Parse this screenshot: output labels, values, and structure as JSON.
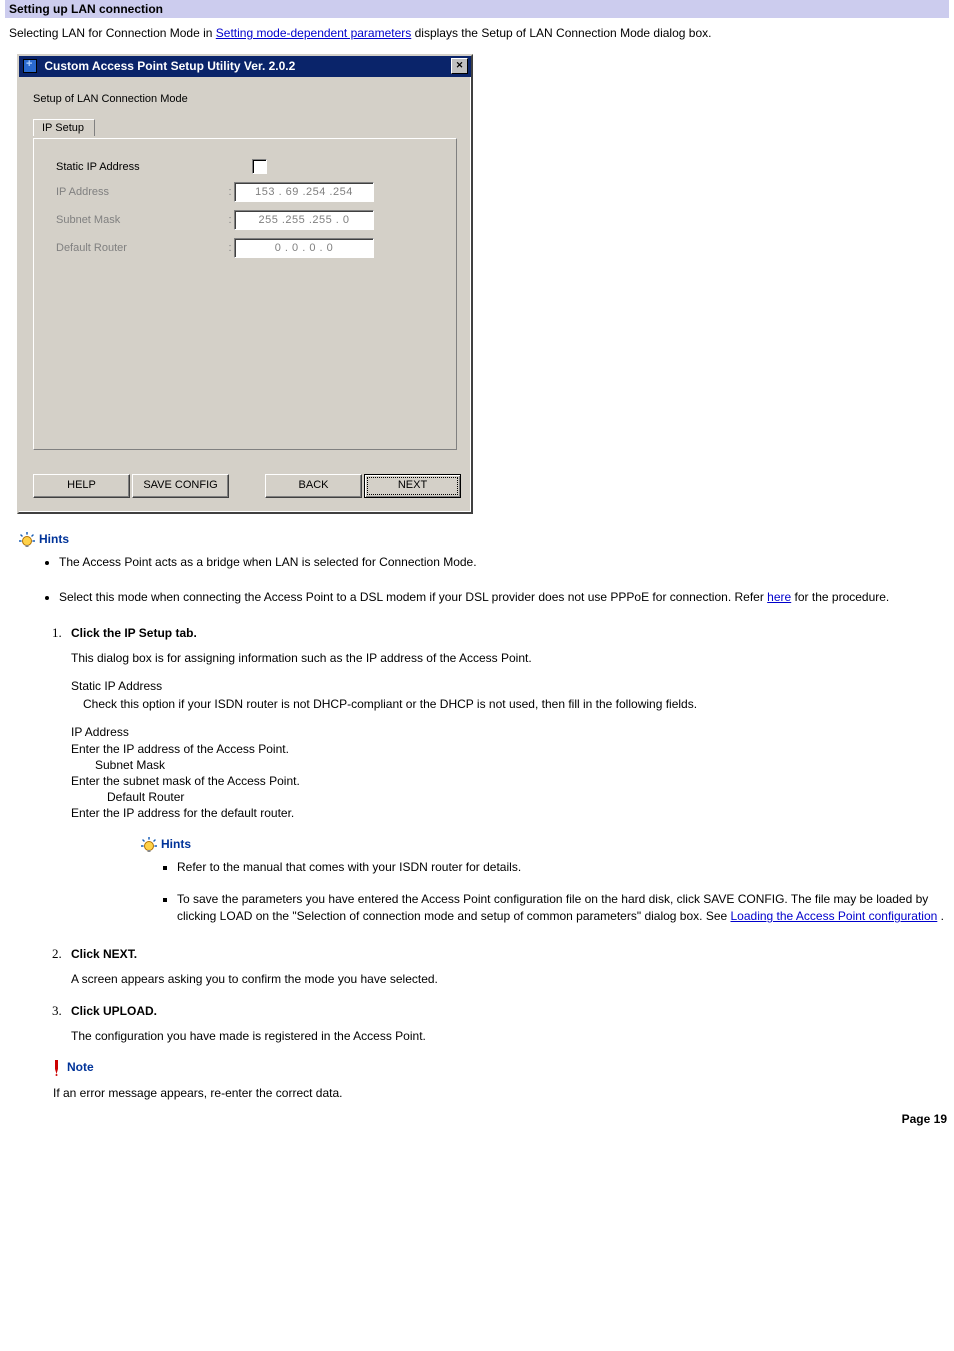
{
  "section_title": "Setting up LAN connection",
  "intro": {
    "prefix": "Selecting LAN for Connection Mode in ",
    "link": "Setting mode-dependent parameters",
    "suffix": " displays the Setup of LAN Connection Mode dialog box."
  },
  "dialog": {
    "title": "Custom Access Point Setup Utility  Ver.  2.0.2",
    "close_glyph": "✕",
    "subtitle": "Setup of LAN Connection Mode",
    "tab_label": "IP Setup",
    "fields": {
      "static_label": "Static IP Address",
      "ip_label": "IP Address",
      "ip_value": "153 . 69  .254 .254",
      "mask_label": "Subnet Mask",
      "mask_value": "255 .255 .255 .  0",
      "router_label": "Default Router",
      "router_value": "0  .  0  .  0  .  0",
      "colon": ":"
    },
    "buttons": {
      "help": "HELP",
      "save": "SAVE CONFIG",
      "back": "BACK",
      "next": "NEXT"
    }
  },
  "hints1": {
    "heading": "Hints",
    "items": [
      {
        "text": "The Access Point acts as a bridge when LAN is selected for Connection Mode."
      },
      {
        "prefix": "Select this mode when connecting the Access Point to a DSL modem if your DSL provider does not use PPPoE for connection. Refer ",
        "link": "here",
        "suffix": " for the procedure."
      }
    ]
  },
  "steps": {
    "step1_title": "Click the IP Setup tab.",
    "step1_p1": "This dialog box is for assigning information such as the IP address of the Access Point.",
    "static_term": "Static IP Address",
    "static_desc": "Check this option if your ISDN router is not DHCP-compliant or the DHCP is not used, then fill in the following fields.",
    "ip_term": "IP Address",
    "ip_desc": "Enter the IP address of the Access Point.",
    "mask_term": "Subnet Mask",
    "mask_desc": "Enter the subnet mask of the Access Point.",
    "router_term": "Default Router",
    "router_desc": "Enter the IP address for the default router.",
    "step2_title": "Click NEXT.",
    "step2_p": "A screen appears asking you to confirm the mode you have selected.",
    "step3_title": "Click UPLOAD.",
    "step3_p": "The configuration you have made is registered in the Access Point."
  },
  "hints2": {
    "heading": "Hints",
    "item1": "Refer to the manual that comes with your ISDN router for details.",
    "item2_prefix": "To save the parameters you have entered the Access Point configuration file on the hard disk, click SAVE CONFIG. The file may be loaded by clicking LOAD on the \"Selection of connection mode and setup of common parameters\" dialog box. See ",
    "item2_link": "Loading the Access Point configuration",
    "item2_suffix": "."
  },
  "note": {
    "heading": "Note",
    "text": "If an error message appears, re-enter the correct data."
  },
  "footer": "Page 19"
}
